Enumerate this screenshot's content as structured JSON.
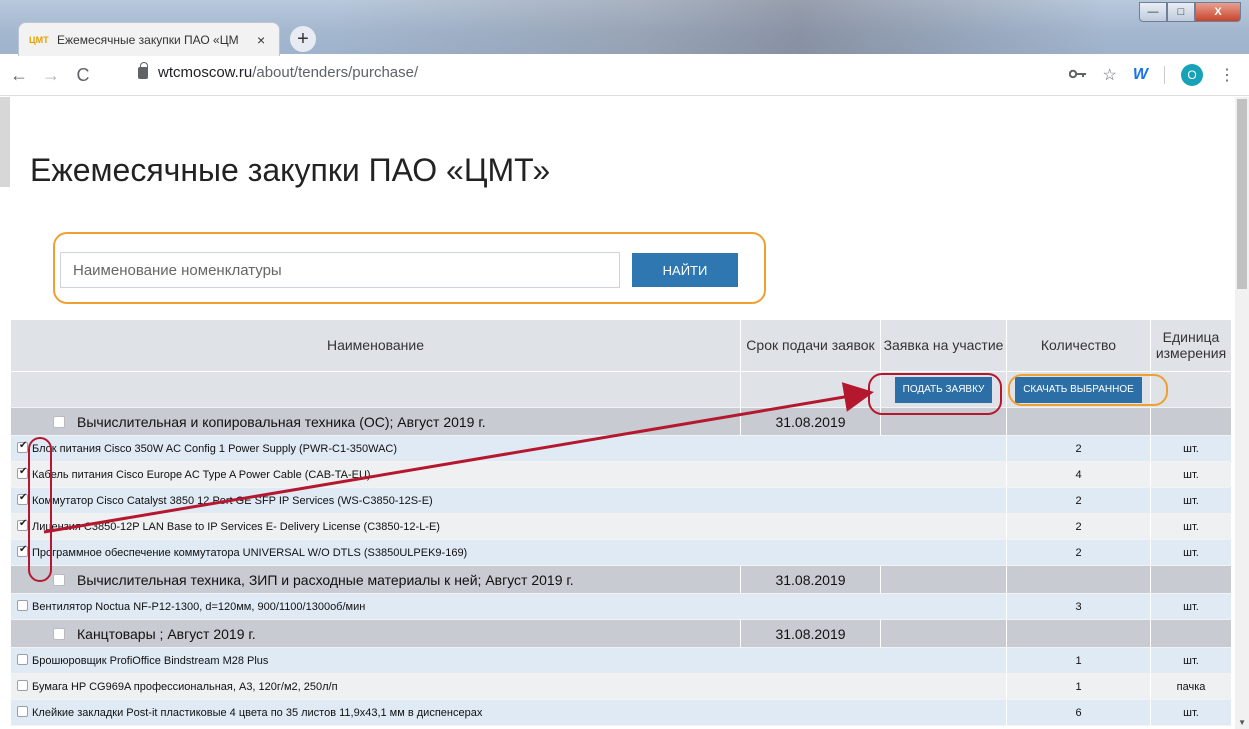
{
  "browser": {
    "tab_favicon": "ЦМТ",
    "tab_title": "Ежемесячные закупки ПАО «ЦМ",
    "tab_close": "×",
    "new_tab": "+",
    "win_min": "—",
    "win_max": "□",
    "win_close": "X",
    "back": "←",
    "forward": "→",
    "reload": "C",
    "url_host": "wtcmoscow.ru",
    "url_path": "/about/tenders/purchase/",
    "key_icon": "key-icon",
    "star": "☆",
    "ext_label": "W",
    "avatar_letter": "O",
    "menu": "⋮"
  },
  "page": {
    "title": "Ежемесячные закупки ПАО «ЦМТ»",
    "search_placeholder": "Наименование номенклатуры",
    "find_button": "НАЙТИ"
  },
  "table": {
    "headers": {
      "name": "Наименование",
      "deadline": "Срок подачи заявок",
      "application": "Заявка на участие",
      "quantity": "Количество",
      "unit": "Единица измерения"
    },
    "submit_button": "ПОДАТЬ ЗАЯВКУ",
    "download_button": "СКАЧАТЬ ВЫБРАННОЕ",
    "groups": [
      {
        "name": "Вычислительная и копировальная техника (ОС); Август 2019 г.",
        "date": "31.08.2019",
        "items": [
          {
            "name": "Блок питания Cisco 350W AC Config 1 Power Supply (PWR-C1-350WAC)",
            "qty": "2",
            "unit": "шт.",
            "checked": true
          },
          {
            "name": "Кабель питания Cisco Europe AC Type A Power Cable (CAB-TA-EU)",
            "qty": "4",
            "unit": "шт.",
            "checked": true
          },
          {
            "name": "Коммутатор Cisco Catalyst 3850 12 Port GE SFP IP Services (WS-C3850-12S-E)",
            "qty": "2",
            "unit": "шт.",
            "checked": true
          },
          {
            "name": "Лицензия C3850-12P LAN Base to IP Services E- Delivery License (C3850-12-L-E)",
            "qty": "2",
            "unit": "шт.",
            "checked": true
          },
          {
            "name": "Программное обеспечение коммутатора UNIVERSAL W/O DTLS (S3850ULPEK9-169)",
            "qty": "2",
            "unit": "шт.",
            "checked": true
          }
        ]
      },
      {
        "name": "Вычислительная техника, ЗИП и расходные материалы к ней; Август 2019 г.",
        "date": "31.08.2019",
        "items": [
          {
            "name": "Вентилятор Noctua NF-P12-1300, d=120мм, 900/1100/1300об/мин",
            "qty": "3",
            "unit": "шт.",
            "checked": false
          }
        ]
      },
      {
        "name": "Канцтовары ; Август 2019 г.",
        "date": "31.08.2019",
        "items": [
          {
            "name": "Брошюровщик ProfiOffice Bindstream M28 Plus",
            "qty": "1",
            "unit": "шт.",
            "checked": false
          },
          {
            "name": "Бумага HP CG969A профессиональная, A3, 120г/м2, 250л/п",
            "qty": "1",
            "unit": "пачка",
            "checked": false
          },
          {
            "name": "Клейкие закладки Post-it пластиковые 4 цвета по 35 листов 11,9х43,1 мм в диспенсерах",
            "qty": "6",
            "unit": "шт.",
            "checked": false
          }
        ]
      }
    ]
  },
  "colors": {
    "accent_button": "#2f77b0",
    "annotation_orange": "#f0a030",
    "annotation_red": "#b5182e"
  }
}
